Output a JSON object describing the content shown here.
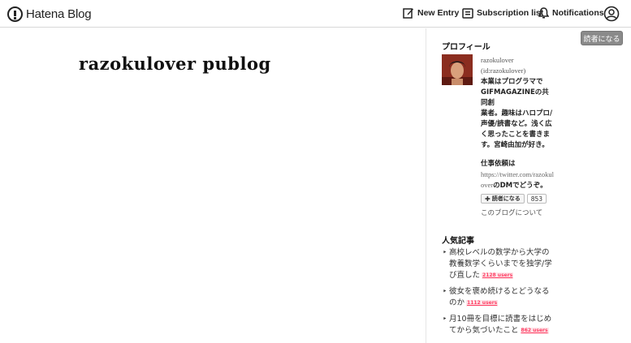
{
  "header": {
    "logo_text": "Hatena Blog",
    "new_entry": "New Entry",
    "subscription_list": "Subscription list",
    "notifications": "Notifications"
  },
  "main": {
    "blog_title": "razokulover publog"
  },
  "sidebar": {
    "reader_button": "読者になる",
    "profile": {
      "heading": "プロフィール",
      "name": "razokulover",
      "id": "(id:razokulover)",
      "bio_lines": [
        "本業はプログラマで",
        "GIFMAGAZINEの共同創",
        "業者。趣味はハロプロ/",
        "声優/読書など。浅く広",
        "く思ったことを書きま",
        "す。宮崎由加が好き。"
      ],
      "work_heading": "仕事依頼は",
      "twitter_line1": "https://twitter.com/razokul",
      "twitter_line2": "over",
      "twitter_suffix": "のDMでどうぞ。",
      "subscribe_label": "読者になる",
      "subscriber_count": "853",
      "about_link": "このブログについて"
    },
    "popular": {
      "heading": "人気記事",
      "items": [
        {
          "title": "高校レベルの数学から大学の教養数学くらいまでを独学/学び直した",
          "users": "2128 users"
        },
        {
          "title": "彼女を褒め続けるとどうなるのか",
          "users": "1112 users"
        },
        {
          "title": "月10冊を目標に読書をはじめてから気づいたこと",
          "users": "862 users"
        }
      ]
    }
  }
}
